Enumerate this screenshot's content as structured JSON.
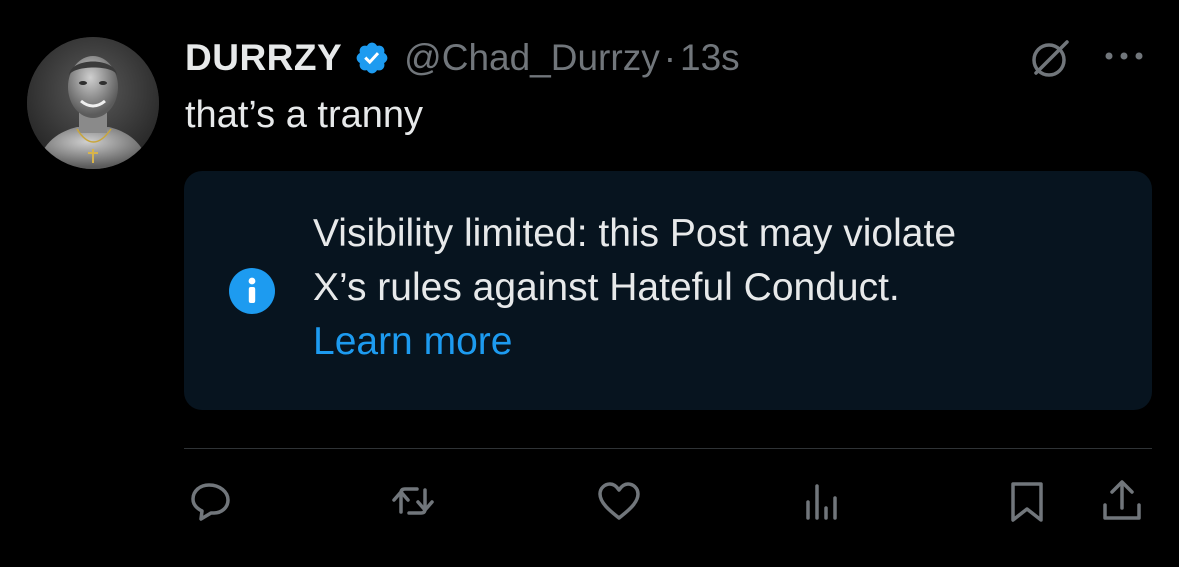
{
  "tweet": {
    "author": {
      "display_name": "DURRZY",
      "handle": "@Chad_Durrzy",
      "verified": true,
      "avatar": "avatar-image"
    },
    "separator": "·",
    "timestamp": "13s",
    "text": "that’s a tranny"
  },
  "notice": {
    "icon": "info-icon",
    "line1": "Visibility limited: this Post may violate",
    "line2": "X’s rules against Hateful Conduct.",
    "link": "Learn more"
  },
  "header_icons": [
    "grok-icon",
    "more-icon"
  ],
  "actions": [
    "reply-icon",
    "retweet-icon",
    "like-icon",
    "views-icon",
    "bookmark-icon",
    "share-icon"
  ],
  "colors": {
    "background": "#000000",
    "text": "#e7e9ea",
    "muted": "#71767b",
    "accent": "#1d9bf0",
    "notice_bg": "#07141f",
    "divider": "#2f3336"
  }
}
